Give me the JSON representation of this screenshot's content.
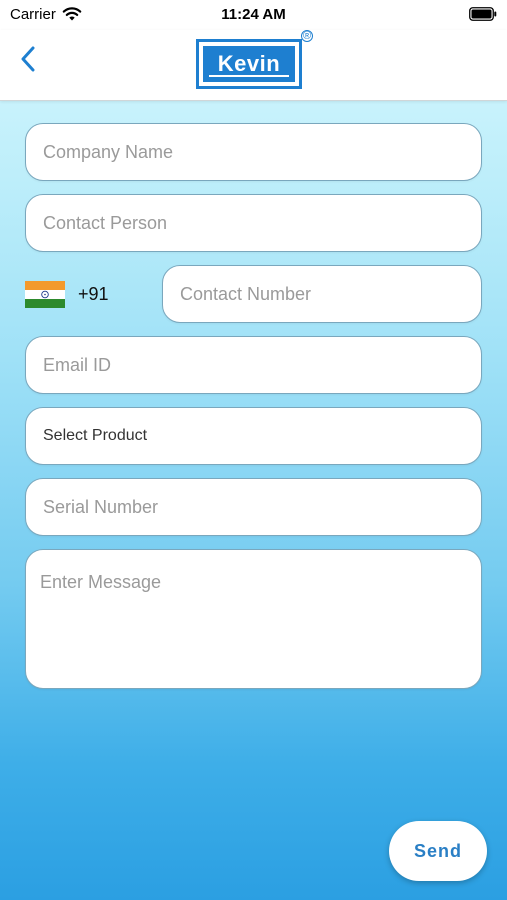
{
  "status_bar": {
    "carrier": "Carrier",
    "time": "11:24 AM"
  },
  "header": {
    "logo_text": "Kevin",
    "registered_mark": "®",
    "back_icon": "chevron-left-icon"
  },
  "form": {
    "company_name_placeholder": "Company Name",
    "contact_person_placeholder": "Contact Person",
    "country_flag": "india-flag-icon",
    "country_code": "+91",
    "contact_number_placeholder": "Contact Number",
    "email_placeholder": "Email ID",
    "product_select_label": "Select Product",
    "serial_number_placeholder": "Serial Number",
    "message_placeholder": "Enter Message"
  },
  "actions": {
    "send_label": "Send"
  },
  "colors": {
    "brand": "#1e7fd0",
    "background_top": "#d7f8ff",
    "background_bottom": "#2b9fe2",
    "send_text": "#2a7fc5"
  }
}
